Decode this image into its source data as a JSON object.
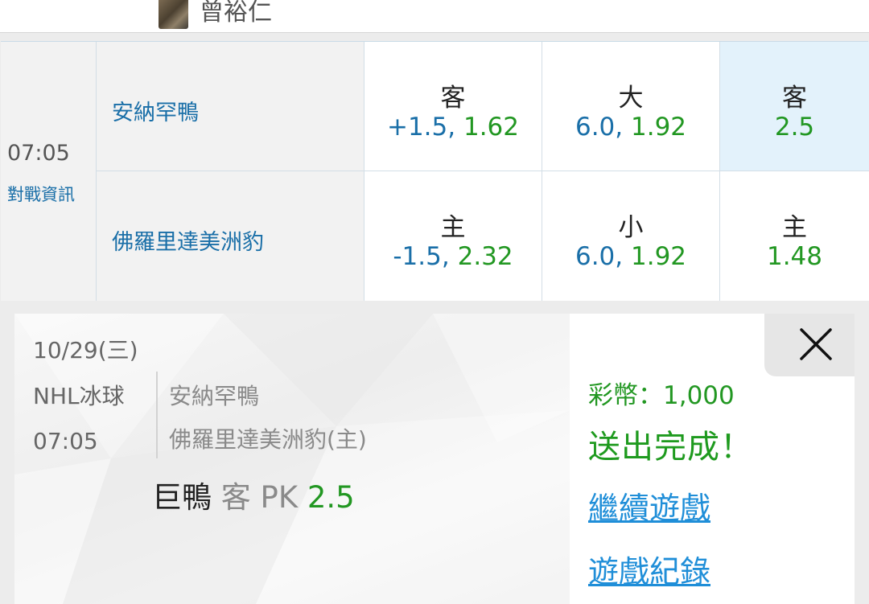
{
  "user": {
    "name": "曾裕仁"
  },
  "game": {
    "time": "07:05",
    "matchup_link": "對戰資訊",
    "away_team": "安納罕鴨",
    "home_team": "佛羅里達美洲豹",
    "spread": {
      "away_label": "客",
      "away_line": "+1.5",
      "away_odds": "1.62",
      "home_label": "主",
      "home_line": "-1.5",
      "home_odds": "2.32"
    },
    "total": {
      "over_label": "大",
      "over_line": "6.0",
      "over_odds": "1.92",
      "under_label": "小",
      "under_line": "6.0",
      "under_odds": "1.92"
    },
    "moneyline": {
      "away_label": "客",
      "away_odds": "2.5",
      "home_label": "主",
      "home_odds": "1.48"
    },
    "separator": ", "
  },
  "bet_slip": {
    "date": "10/29(三)",
    "sport": "NHL冰球",
    "time": "07:05",
    "away_team": "安納罕鴨",
    "home_team": "佛羅里達美洲豹(主)",
    "pick_team": "巨鴨",
    "pick_side": "客 PK",
    "pick_odds": "2.5",
    "coins": "彩幣：1,000",
    "status": "送出完成！",
    "continue_link": "繼續遊戲",
    "history_link": "遊戲紀錄"
  },
  "colors": {
    "link_blue": "#1a6fa8",
    "odds_green": "#229722",
    "selected_bg": "#e3f2fb",
    "action_link": "#1f8ed8"
  }
}
